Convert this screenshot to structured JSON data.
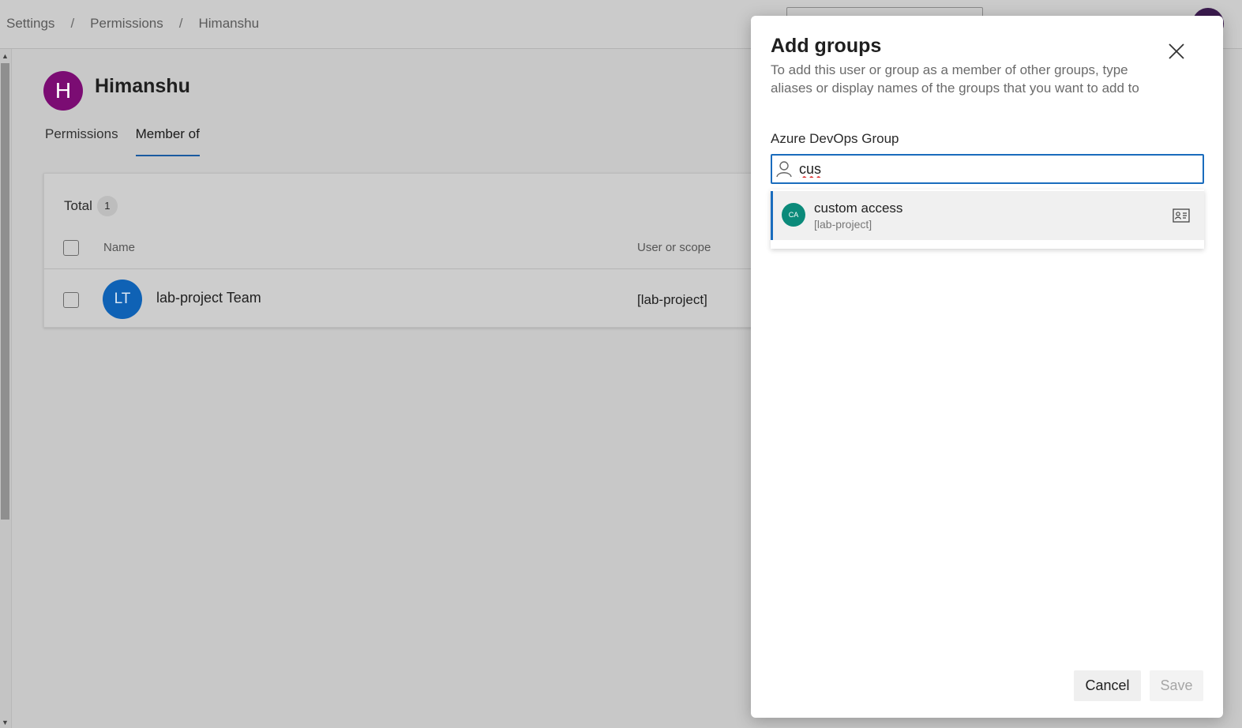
{
  "breadcrumb": [
    "Settings",
    "Permissions",
    "Himanshu"
  ],
  "user": {
    "initial": "H",
    "name": "Himanshu",
    "avatar_color": "#7b0c73"
  },
  "tabs": [
    {
      "label": "Permissions",
      "active": false
    },
    {
      "label": "Member of",
      "active": true
    }
  ],
  "members": {
    "total_label": "Total",
    "total_count": "1",
    "columns": {
      "name": "Name",
      "scope": "User or scope"
    },
    "rows": [
      {
        "initials": "LT",
        "name": "lab-project Team",
        "scope": "[lab-project]",
        "avatar_color": "#0f62b5"
      }
    ]
  },
  "dialog": {
    "title": "Add groups",
    "description": "To add this user or group as a member of other groups, type aliases or display names of the groups that you want to add to",
    "field_label": "Azure DevOps Group",
    "search_value": "cus",
    "suggestions": [
      {
        "initials": "CA",
        "name": "custom access",
        "scope": "[lab-project]",
        "avatar_color": "#0b8a7a"
      }
    ],
    "cancel_label": "Cancel",
    "save_label": "Save"
  },
  "colors": {
    "accent": "#1a6cbd"
  },
  "icons": {
    "close": "close-icon",
    "person": "person-icon",
    "contact_card": "contact-card-icon"
  }
}
